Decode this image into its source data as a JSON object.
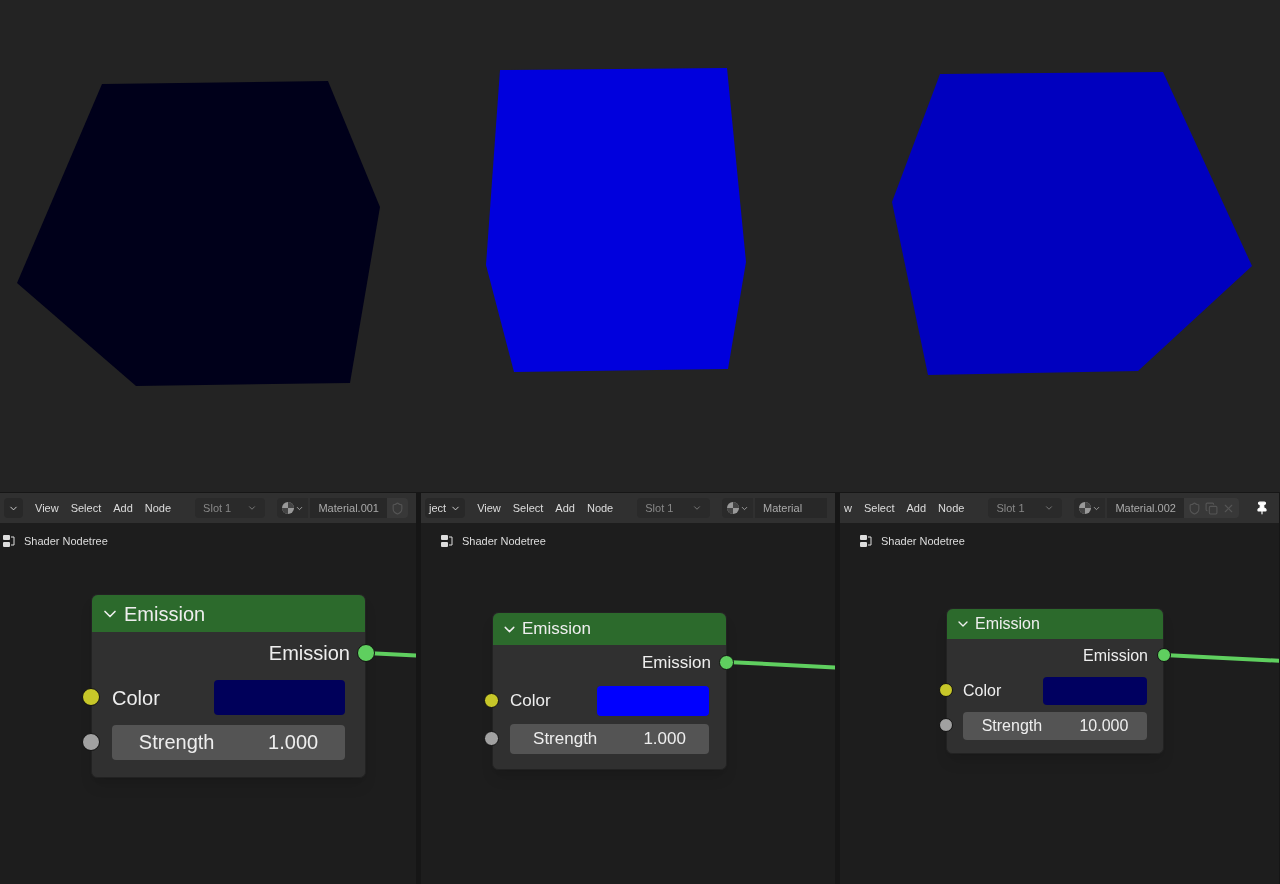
{
  "viewport": {
    "objects": [
      {
        "color": "#00001a"
      },
      {
        "color": "#0000dd"
      },
      {
        "color": "#0000bf"
      }
    ]
  },
  "editors": [
    {
      "editor_dropdown": true,
      "menus": [
        "View",
        "Select",
        "Add",
        "Node"
      ],
      "slot": "Slot 1",
      "material": "Material.001",
      "material_icons": [
        {
          "kind": "shield"
        }
      ],
      "pinned": false,
      "breadcrumb": "Shader Nodetree",
      "node": {
        "title": "Emission",
        "output": "Emission",
        "inputs": [
          {
            "kind": "color",
            "label": "Color",
            "color": "#00005a"
          },
          {
            "kind": "value",
            "label": "Strength",
            "value": "1.000"
          }
        ]
      }
    },
    {
      "editor_dropdown": true,
      "editor_type": "ject",
      "menus": [
        "View",
        "Select",
        "Add",
        "Node"
      ],
      "slot": "Slot 1",
      "material": "Material",
      "pinned": false,
      "breadcrumb": "Shader Nodetree",
      "node": {
        "title": "Emission",
        "output": "Emission",
        "inputs": [
          {
            "kind": "color",
            "label": "Color",
            "color": "#0000ff"
          },
          {
            "kind": "value",
            "label": "Strength",
            "value": "1.000"
          }
        ]
      }
    },
    {
      "editor_dropdown": false,
      "menus": [
        "w",
        "Select",
        "Add",
        "Node"
      ],
      "slot": "Slot 1",
      "material": "Material.002",
      "material_icons": [
        {
          "kind": "shield"
        },
        {
          "kind": "copy"
        },
        {
          "kind": "close"
        }
      ],
      "pinned": true,
      "breadcrumb": "Shader Nodetree",
      "node": {
        "title": "Emission",
        "output": "Emission",
        "inputs": [
          {
            "kind": "color",
            "label": "Color",
            "color": "#000060"
          },
          {
            "kind": "value",
            "label": "Strength",
            "value": "10.000"
          }
        ]
      }
    }
  ]
}
